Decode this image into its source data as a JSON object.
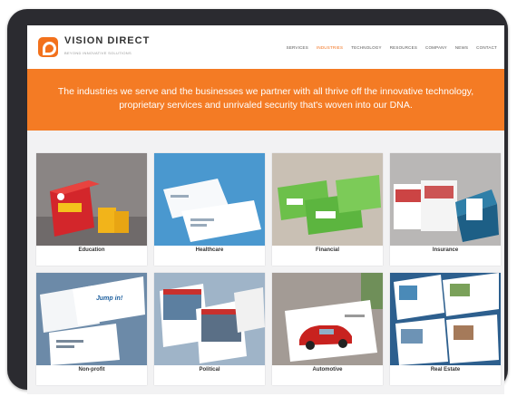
{
  "brand": {
    "name": "VISION DIRECT",
    "tagline": "BEYOND INNOVATIVE SOLUTIONS"
  },
  "nav": [
    "SERVICES",
    "INDUSTRIES",
    "TECHNOLOGY",
    "RESOURCES",
    "COMPANY",
    "NEWS",
    "CONTACT"
  ],
  "nav_active": "INDUSTRIES",
  "hero": {
    "text": "The industries we serve and the businesses we partner with all thrive off the innovative technology, proprietary services and unrivaled security that's woven into our DNA."
  },
  "industries": [
    "Education",
    "Healthcare",
    "Financial",
    "Insurance",
    "Non-profit",
    "Political",
    "Automotive",
    "Real Estate"
  ],
  "colors": {
    "accent": "#f47b24",
    "frame": "#2b2b30"
  }
}
